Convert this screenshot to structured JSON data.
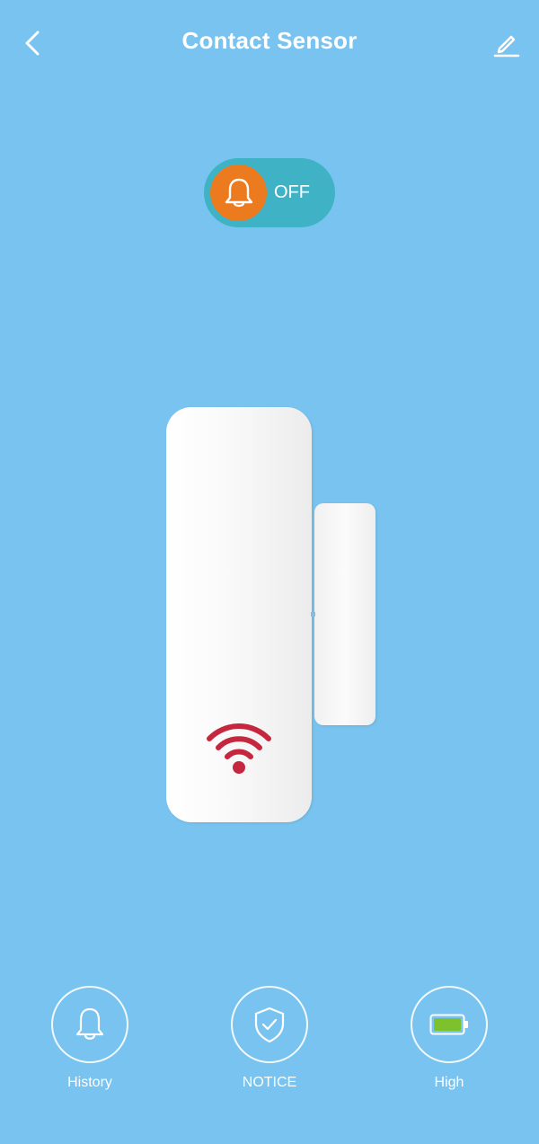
{
  "header": {
    "title": "Contact Sensor"
  },
  "alarm": {
    "state_label": "OFF",
    "is_on": false
  },
  "bottom_bar": {
    "history_label": "History",
    "notice_label": "NOTICE",
    "battery_label": "High"
  },
  "colors": {
    "background": "#78C3EF",
    "toggle_track": "#3FB3C5",
    "toggle_knob": "#EC7A1E",
    "wifi_signal": "#C5273F",
    "battery_fill": "#7DC22C"
  },
  "icons": {
    "back": "chevron-left-icon",
    "edit": "pencil-icon",
    "alarm": "bell-icon",
    "signal": "wifi-icon",
    "history": "bell-icon",
    "notice": "shield-check-icon",
    "battery": "battery-icon"
  }
}
